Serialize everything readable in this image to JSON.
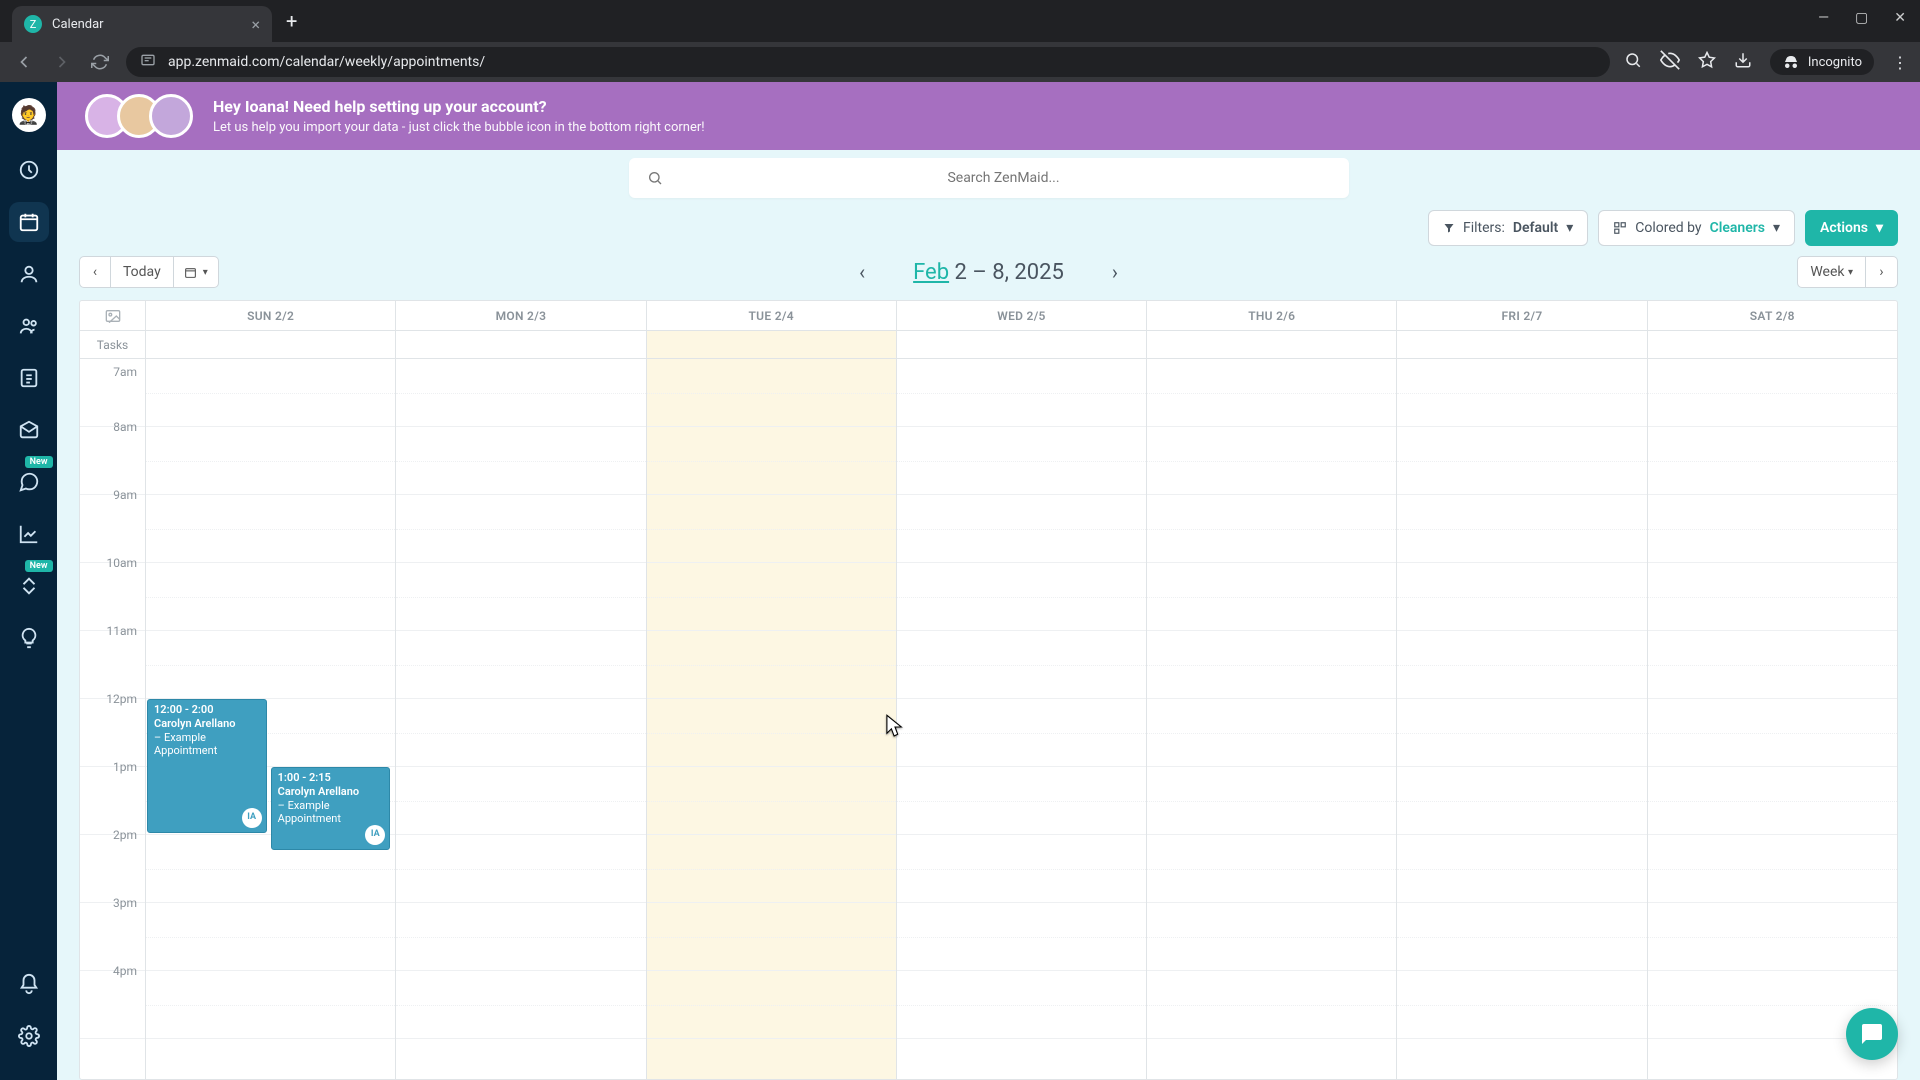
{
  "browser": {
    "tab_title": "Calendar",
    "url": "app.zenmaid.com/calendar/weekly/appointments/",
    "incognito_label": "Incognito"
  },
  "banner": {
    "title": "Hey Ioana! Need help setting up your account?",
    "subtitle": "Let us help you import your data - just click the bubble icon in the bottom right corner!"
  },
  "search": {
    "placeholder": "Search ZenMaid..."
  },
  "toolbar": {
    "filters_prefix": "Filters:",
    "filters_value": "Default",
    "colored_prefix": "Colored by",
    "colored_value": "Cleaners",
    "actions": "Actions"
  },
  "nav": {
    "today": "Today",
    "month": "Feb",
    "range": "2 – 8, 2025",
    "view": "Week"
  },
  "calendar": {
    "tasks_label": "Tasks",
    "days": [
      "SUN 2/2",
      "MON 2/3",
      "TUE 2/4",
      "WED 2/5",
      "THU 2/6",
      "FRI 2/7",
      "SAT 2/8"
    ],
    "today_index": 2,
    "hours": [
      "7am",
      "8am",
      "9am",
      "10am",
      "11am",
      "12pm",
      "1pm",
      "2pm",
      "3pm",
      "4pm"
    ]
  },
  "events": [
    {
      "day_index": 0,
      "time": "12:00 - 2:00",
      "title": "Carolyn Arellano",
      "sub": "– Example Appointment",
      "badge": "IA",
      "slot": "left",
      "top_hour": 5,
      "height_hours": 2
    },
    {
      "day_index": 0,
      "time": "1:00 - 2:15",
      "title": "Carolyn Arellano",
      "sub": "– Example Appointment",
      "badge": "IA",
      "slot": "right",
      "top_hour": 6,
      "height_hours": 1.25
    }
  ],
  "sidebar": {
    "new_badge": "New"
  }
}
